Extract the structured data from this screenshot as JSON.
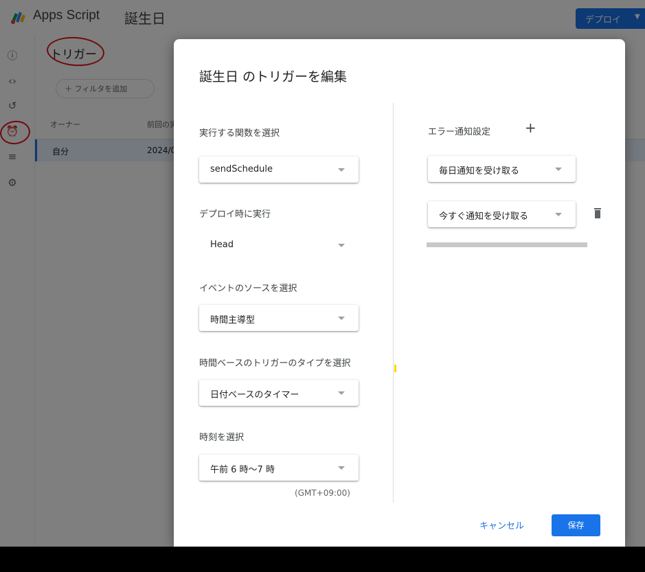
{
  "app": {
    "name": "Apps Script",
    "project": "誕生日",
    "deploy_label": "デプロイ"
  },
  "main": {
    "title": "トリガー",
    "filter_label": "＋ フィルタを追加",
    "columns": {
      "owner": "オーナー",
      "last_run": "前回の実"
    },
    "row": {
      "owner": "自分",
      "last_run": "2024/0"
    }
  },
  "dialog": {
    "title": "誕生日 のトリガーを編集",
    "function": {
      "label": "実行する関数を選択",
      "value": "sendSchedule"
    },
    "deployment": {
      "label": "デプロイ時に実行",
      "value": "Head"
    },
    "event_source": {
      "label": "イベントのソースを選択",
      "value": "時間主導型"
    },
    "timer_type": {
      "label": "時間ベースのトリガーのタイプを選択",
      "value": "日付ベースのタイマー"
    },
    "time": {
      "label": "時刻を選択",
      "value": "午前 6 時～7 時"
    },
    "timezone": "(GMT+09:00)",
    "error_notify": {
      "label": "エラー通知設定",
      "first": "毎日通知を受け取る",
      "second": "今すぐ通知を受け取る"
    },
    "cancel": "キャンセル",
    "save": "保存"
  },
  "colors": {
    "accent": "#1a73e8",
    "annotation": "#e0141e"
  }
}
